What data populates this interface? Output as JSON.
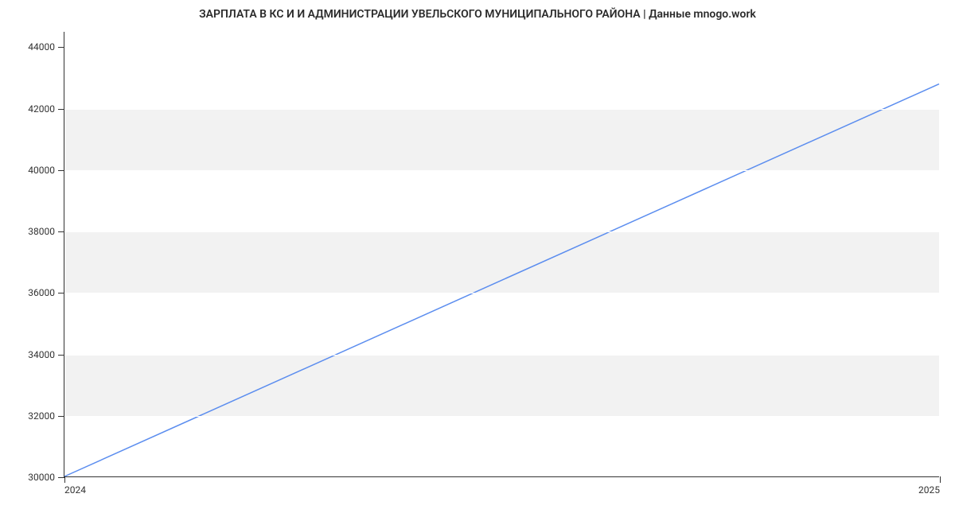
{
  "chart_data": {
    "type": "line",
    "title": "ЗАРПЛАТА В КС И И АДМИНИСТРАЦИИ УВЕЛЬСКОГО МУНИЦИПАЛЬНОГО РАЙОНА | Данные mnogo.work",
    "x": [
      "2024",
      "2025"
    ],
    "x_ticks": [
      "2024",
      "2025"
    ],
    "values": [
      30000,
      42800
    ],
    "y_ticks": [
      30000,
      32000,
      34000,
      36000,
      38000,
      40000,
      42000,
      44000
    ],
    "ylim": [
      30000,
      44500
    ],
    "xlabel": "",
    "ylabel": "",
    "line_color": "#5b8def",
    "band_color": "#f2f2f2"
  }
}
